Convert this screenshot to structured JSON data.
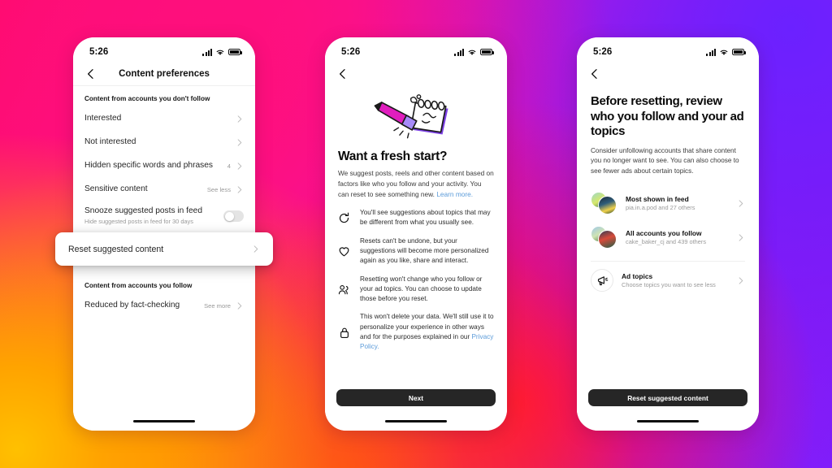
{
  "theme": {
    "accent_link": "#5b9bd9",
    "button_bg": "#262626",
    "text_primary": "#262626",
    "text_muted": "#9a9a9a",
    "pencil_pink": "#E01EBE",
    "pencil_purple": "#8B5CF6"
  },
  "status_bar": {
    "time": "5:26",
    "signal_icon": "signal-bars-icon",
    "wifi_icon": "wifi-icon",
    "battery_icon": "battery-icon"
  },
  "phone1": {
    "nav": {
      "back_icon": "back-chevron-icon",
      "title": "Content preferences"
    },
    "section1_header": "Content from accounts you don't follow",
    "rows": [
      {
        "title": "Interested",
        "value": "",
        "chevron": "chevron-right-icon"
      },
      {
        "title": "Not interested",
        "value": "",
        "chevron": "chevron-right-icon"
      },
      {
        "title": "Hidden specific words and phrases",
        "value": "4",
        "chevron": "chevron-right-icon"
      },
      {
        "title": "Sensitive content",
        "value": "See less",
        "chevron": "chevron-right-icon"
      }
    ],
    "snooze": {
      "title": "Snooze suggested posts in feed",
      "subtitle": "Hide suggested posts in feed for 30 days",
      "toggle_state": "off"
    },
    "callout": {
      "label": "Reset suggested content",
      "chevron": "chevron-right-icon"
    },
    "section2_header": "Content from accounts you follow",
    "row_factcheck": {
      "title": "Reduced by fact-checking",
      "value": "See more",
      "chevron": "chevron-right-icon"
    }
  },
  "phone2": {
    "nav": {
      "back_icon": "back-chevron-icon"
    },
    "illustration": "pencil-erasing-notepad-illustration",
    "title": "Want a fresh start?",
    "body": "We suggest posts, reels and other content based on factors like who you follow and your activity. You can reset to see something new. ",
    "body_link": "Learn more.",
    "bullets": [
      {
        "icon": "refresh-icon",
        "text": "You'll see suggestions about topics that may be different from what you usually see."
      },
      {
        "icon": "heart-icon",
        "text": "Resets can't be undone, but your suggestions will become more personalized again as you like, share and interact."
      },
      {
        "icon": "people-icon",
        "text": "Resetting won't change who you follow or your ad topics. You can choose to update those before you reset."
      },
      {
        "icon": "lock-icon",
        "text": "This won't delete your data. We'll still use it to personalize your experience in other ways and for the purposes explained in our ",
        "link": "Privacy Policy."
      }
    ],
    "button": "Next"
  },
  "phone3": {
    "nav": {
      "back_icon": "back-chevron-icon"
    },
    "title": "Before resetting, review who you follow and your ad topics",
    "subtitle": "Consider unfollowing accounts that share content you no longer want to see. You can also choose to see fewer ads about certain topics.",
    "accounts": [
      {
        "icon": "avatar-stack",
        "title": "Most shown in feed",
        "subtitle": "pia.in.a.pod and 27 others",
        "chevron": "chevron-right-icon"
      },
      {
        "icon": "avatar-stack",
        "title": "All accounts you follow",
        "subtitle": "cake_baker_cj and 439 others",
        "chevron": "chevron-right-icon"
      }
    ],
    "ad_topics": {
      "icon": "megaphone-icon",
      "title": "Ad topics",
      "subtitle": "Choose topics you want to see less",
      "chevron": "chevron-right-icon"
    },
    "button": "Reset suggested content"
  }
}
